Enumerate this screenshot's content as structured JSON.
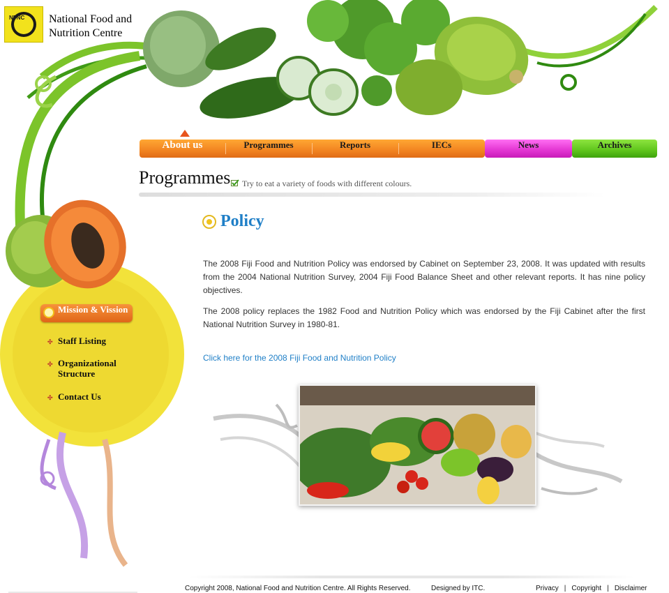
{
  "header": {
    "logo_mark": "NFNC",
    "logo_line1": "National Food and",
    "logo_line2": "Nutrition Centre"
  },
  "nav": {
    "items": [
      {
        "label": "About us",
        "active": true
      },
      {
        "label": "Programmes",
        "active": false
      },
      {
        "label": "Reports",
        "active": false
      },
      {
        "label": "IECs",
        "active": false
      },
      {
        "label": "News",
        "active": false
      },
      {
        "label": "Archives",
        "active": false
      }
    ],
    "colors": {
      "orange": "#f28421",
      "pink": "#e234d2",
      "green": "#5fc51c"
    }
  },
  "page": {
    "title": "Programmes",
    "tagline": "Try to eat a variety of foods with different colours."
  },
  "sidebar": {
    "items": [
      {
        "label": "Mission & Vission",
        "active": true
      },
      {
        "label": "Staff Listing"
      },
      {
        "label": "Organizational Structure"
      },
      {
        "label": "Contact Us"
      }
    ]
  },
  "content": {
    "heading": "Policy",
    "paragraph1": "The 2008 Fiji Food and Nutrition Policy was endorsed by Cabinet on September 23, 2008. It was updated with results from the 2004 National Nutrition Survey, 2004 Fiji Food Balance Sheet and other relevant reports. It has nine policy objectives.",
    "paragraph2": "The 2008 policy replaces the 1982 Food and Nutrition Policy which was endorsed by the Fiji Cabinet after the first National Nutrition Survey in 1980-81.",
    "link": "Click here for the 2008 Fiji Food and Nutrition Policy",
    "heading_color": "#1f7fc7"
  },
  "footer": {
    "copyright": "Copyright 2008, National Food and Nutrition Centre. All Rights Reserved.",
    "designed_by": "Designed by ITC.",
    "links": [
      "Privacy",
      "Copyright",
      "Disclaimer"
    ]
  }
}
